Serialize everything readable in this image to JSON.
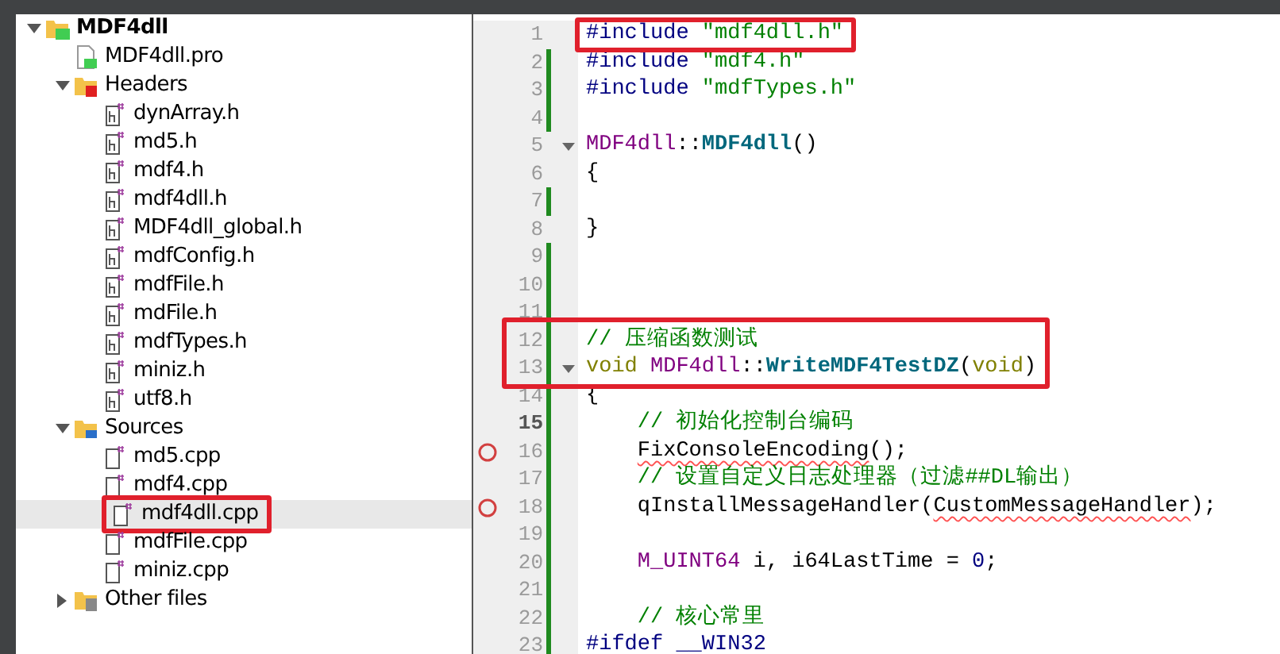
{
  "project_tree": [
    {
      "label": "MDF4dll",
      "kind": "project",
      "expanded": true,
      "children": [
        {
          "label": "MDF4dll.pro",
          "kind": "pro",
          "selected": false,
          "boxed": false
        },
        {
          "label": "Headers",
          "kind": "folder-h",
          "expanded": true,
          "children": [
            {
              "label": "dynArray.h",
              "kind": "header",
              "selected": false,
              "boxed": false
            },
            {
              "label": "md5.h",
              "kind": "header",
              "selected": false,
              "boxed": false
            },
            {
              "label": "mdf4.h",
              "kind": "header",
              "selected": false,
              "boxed": false
            },
            {
              "label": "mdf4dll.h",
              "kind": "header",
              "selected": false,
              "boxed": false
            },
            {
              "label": "MDF4dll_global.h",
              "kind": "header",
              "selected": false,
              "boxed": false
            },
            {
              "label": "mdfConfig.h",
              "kind": "header",
              "selected": false,
              "boxed": false
            },
            {
              "label": "mdfFile.h",
              "kind": "header",
              "selected": false,
              "boxed": false
            },
            {
              "label": "mdFile.h",
              "kind": "header",
              "selected": false,
              "boxed": false
            },
            {
              "label": "mdfTypes.h",
              "kind": "header",
              "selected": false,
              "boxed": false
            },
            {
              "label": "miniz.h",
              "kind": "header",
              "selected": false,
              "boxed": false
            },
            {
              "label": "utf8.h",
              "kind": "header",
              "selected": false,
              "boxed": false
            }
          ]
        },
        {
          "label": "Sources",
          "kind": "folder-cpp",
          "expanded": true,
          "children": [
            {
              "label": "md5.cpp",
              "kind": "source",
              "selected": false,
              "boxed": false
            },
            {
              "label": "mdf4.cpp",
              "kind": "source",
              "selected": false,
              "boxed": false
            },
            {
              "label": "mdf4dll.cpp",
              "kind": "source",
              "selected": true,
              "boxed": true
            },
            {
              "label": "mdfFile.cpp",
              "kind": "source",
              "selected": false,
              "boxed": false
            },
            {
              "label": "miniz.cpp",
              "kind": "source",
              "selected": false,
              "boxed": false
            }
          ]
        },
        {
          "label": "Other files",
          "kind": "folder-other",
          "expanded": false
        }
      ]
    }
  ],
  "editor": {
    "lines": [
      {
        "number": "1",
        "boxed": true,
        "tokens": [
          {
            "text": "#include",
            "kind": "preprocessor"
          },
          {
            "text": " \"mdf4dll.h\"",
            "kind": "string"
          }
        ]
      },
      {
        "number": "2",
        "modified": true,
        "tokens": [
          {
            "text": "#include",
            "kind": "preprocessor"
          },
          {
            "text": " \"mdf4.h\"",
            "kind": "string"
          }
        ]
      },
      {
        "number": "3",
        "modified": true,
        "tokens": [
          {
            "text": "#include",
            "kind": "preprocessor"
          },
          {
            "text": " \"mdfTypes.h\"",
            "kind": "string"
          }
        ]
      },
      {
        "number": "4",
        "modified": true
      },
      {
        "number": "5",
        "foldable": true,
        "tokens": [
          {
            "text": "MDF4dll",
            "kind": "class"
          },
          {
            "text": "::",
            "kind": "plain"
          },
          {
            "text": "MDF4dll",
            "kind": "function"
          },
          {
            "text": "()",
            "kind": "plain"
          }
        ]
      },
      {
        "number": "6",
        "tokens": [
          {
            "text": "{",
            "kind": "plain"
          }
        ]
      },
      {
        "number": "7",
        "modified": true
      },
      {
        "number": "8",
        "tokens": [
          {
            "text": "}",
            "kind": "plain"
          }
        ]
      },
      {
        "number": "9",
        "modified": true
      },
      {
        "number": "10",
        "modified": true
      },
      {
        "number": "11",
        "modified": true
      },
      {
        "number": "12",
        "modified": true,
        "boxed": true,
        "tokens": [
          {
            "text": "// 压缩函数测试",
            "kind": "comment"
          }
        ]
      },
      {
        "number": "13",
        "modified": true,
        "boxed": true,
        "foldable": true,
        "tokens": [
          {
            "text": "void",
            "kind": "keyword"
          },
          {
            "text": " MDF4dll",
            "kind": "class"
          },
          {
            "text": "::",
            "kind": "plain"
          },
          {
            "text": "WriteMDF4TestDZ",
            "kind": "function"
          },
          {
            "text": "(",
            "kind": "plain"
          },
          {
            "text": "void",
            "kind": "keyword"
          },
          {
            "text": ")",
            "kind": "plain"
          }
        ]
      },
      {
        "number": "14",
        "modified": true,
        "tokens": [
          {
            "text": "{",
            "kind": "plain"
          }
        ]
      },
      {
        "number": "15",
        "modified": true,
        "current": true,
        "indented": true,
        "tokens": [
          {
            "text": "// 初始化控制台编码",
            "kind": "comment"
          }
        ]
      },
      {
        "number": "16",
        "modified": true,
        "breakpoint": true,
        "indented": true,
        "tokens": [
          {
            "text": "FixConsoleEncoding",
            "kind": "plain",
            "error": true
          },
          {
            "text": "();",
            "kind": "plain"
          }
        ]
      },
      {
        "number": "17",
        "modified": true,
        "indented": true,
        "tokens": [
          {
            "text": "// 设置自定义日志处理器（过滤##DL输出）",
            "kind": "comment"
          }
        ]
      },
      {
        "number": "18",
        "modified": true,
        "breakpoint": true,
        "indented": true,
        "tokens": [
          {
            "text": "qInstallMessageHandler(",
            "kind": "plain"
          },
          {
            "text": "CustomMessageHandler",
            "kind": "plain",
            "error": true
          },
          {
            "text": ");",
            "kind": "plain"
          }
        ]
      },
      {
        "number": "19",
        "modified": true
      },
      {
        "number": "20",
        "modified": true,
        "indented": true,
        "tokens": [
          {
            "text": "M_UINT64",
            "kind": "class"
          },
          {
            "text": " i, i64LastTime = ",
            "kind": "plain"
          },
          {
            "text": "0",
            "kind": "number"
          },
          {
            "text": ";",
            "kind": "plain"
          }
        ]
      },
      {
        "number": "21",
        "modified": true
      },
      {
        "number": "22",
        "modified": true,
        "indented": true,
        "tokens": [
          {
            "text": "// 核心常里",
            "kind": "comment"
          }
        ]
      },
      {
        "number": "23",
        "modified": true,
        "tokens": [
          {
            "text": "#ifdef __WIN32",
            "kind": "preprocessor"
          }
        ]
      }
    ]
  }
}
